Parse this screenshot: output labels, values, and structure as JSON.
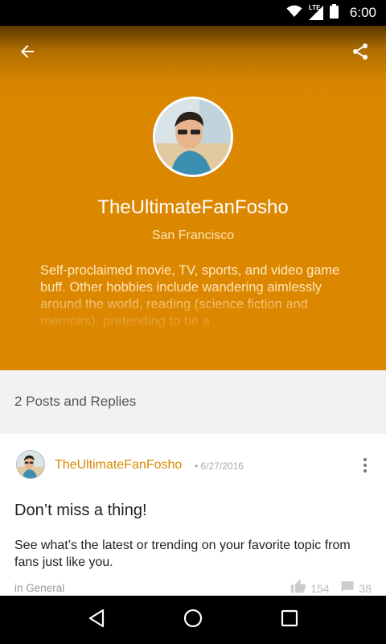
{
  "status_bar": {
    "network": "LTE",
    "time": "6:00"
  },
  "profile": {
    "username": "TheUltimateFanFosho",
    "location": "San Francisco",
    "bio": "Self-proclaimed movie, TV, sports, and video game buff. Other hobbies include wandering aimlessly around the world, reading (science fiction and memoirs), pretending to be a",
    "accent_color": "#DC8700"
  },
  "posts_section": {
    "count_label": "2 Posts and Replies"
  },
  "post": {
    "author": "TheUltimateFanFosho",
    "date": "• 6/27/2016",
    "title": "Don’t miss a thing!",
    "body": "See what’s the latest or trending on your favorite topic from fans just like you.",
    "category": "in General",
    "likes": "154",
    "comments": "38"
  },
  "icons": {
    "back": "arrow-back-icon",
    "share": "share-icon",
    "more": "more-vert-icon",
    "like": "thumb-up-icon",
    "comment": "comment-icon",
    "nav_back": "nav-back-icon",
    "nav_home": "nav-home-icon",
    "nav_recents": "nav-recents-icon"
  }
}
